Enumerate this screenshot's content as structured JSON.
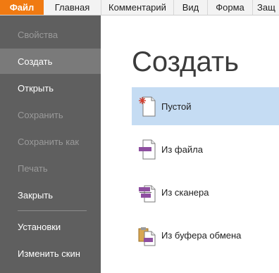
{
  "ribbon": {
    "tabs": [
      {
        "label": "Файл"
      },
      {
        "label": "Главная"
      },
      {
        "label": "Комментарий"
      },
      {
        "label": "Вид"
      },
      {
        "label": "Форма"
      },
      {
        "label": "Защ"
      }
    ]
  },
  "sidebar": {
    "items": [
      {
        "label": "Свойства",
        "state": "disabled"
      },
      {
        "label": "Создать",
        "state": "active"
      },
      {
        "label": "Открыть",
        "state": "enabled"
      },
      {
        "label": "Сохранить",
        "state": "disabled"
      },
      {
        "label": "Сохранить как",
        "state": "disabled"
      },
      {
        "label": "Печать",
        "state": "disabled"
      },
      {
        "label": "Закрыть",
        "state": "enabled"
      },
      {
        "label": "Установки",
        "state": "enabled"
      },
      {
        "label": "Изменить скин",
        "state": "enabled"
      }
    ]
  },
  "main": {
    "title": "Создать",
    "options": [
      {
        "label": "Пустой",
        "icon": "blank-document-icon",
        "selected": true
      },
      {
        "label": "Из файла",
        "icon": "from-file-icon",
        "selected": false
      },
      {
        "label": "Из сканера",
        "icon": "scanner-icon",
        "selected": false
      },
      {
        "label": "Из буфера обмена",
        "icon": "clipboard-icon",
        "selected": false
      }
    ]
  },
  "colors": {
    "accent": "#f07a12",
    "sidebar_bg": "#5f5f5f",
    "sidebar_active": "#7a7a7a",
    "selection": "#c5dcf3",
    "icon_purple": "#8e4fa0"
  }
}
